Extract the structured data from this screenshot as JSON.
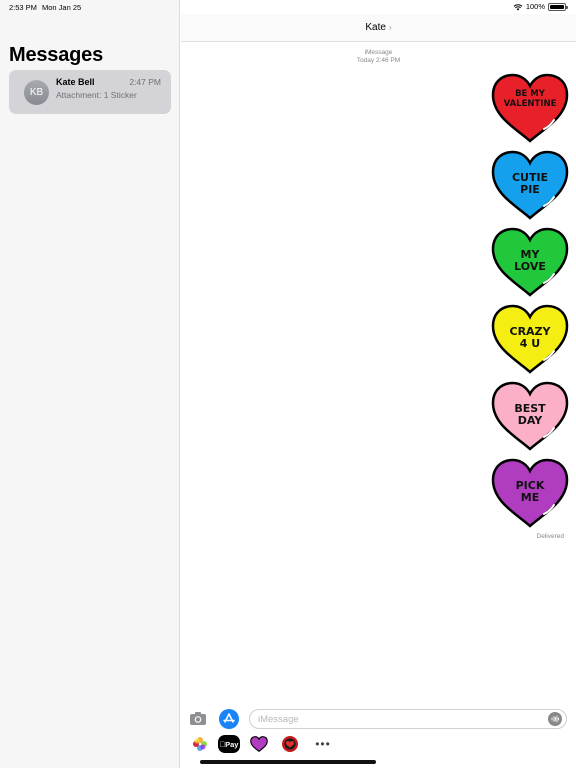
{
  "status_bar": {
    "time": "2:53 PM",
    "date": "Mon Jan 25",
    "battery": "100%"
  },
  "sidebar": {
    "title": "Messages",
    "conversations": [
      {
        "initials": "KB",
        "name": "Kate Bell",
        "time": "2:47 PM",
        "preview": "Attachment: 1 Sticker"
      }
    ]
  },
  "chat": {
    "contact": "Kate",
    "service_label": "iMessage",
    "timestamp": "Today 2:46 PM",
    "stickers": [
      {
        "line1": "BE MY",
        "line2": "VALENTINE",
        "color": "#e8202a"
      },
      {
        "line1": "CUTIE",
        "line2": "PIE",
        "color": "#14a0ec"
      },
      {
        "line1": "MY",
        "line2": "LOVE",
        "color": "#22c83c"
      },
      {
        "line1": "CRAZY",
        "line2": "4 U",
        "color": "#f5ee12"
      },
      {
        "line1": "BEST",
        "line2": "DAY",
        "color": "#fbb0c8"
      },
      {
        "line1": "PICK",
        "line2": "ME",
        "color": "#b03cc0"
      }
    ],
    "delivery_status": "Delivered"
  },
  "input": {
    "placeholder": "iMessage"
  },
  "app_strip": {
    "applepay_label": "Pay",
    "more_label": "•••"
  },
  "colors": {
    "accent": "#1a84f6",
    "selected_row": "#d4d4d8"
  }
}
